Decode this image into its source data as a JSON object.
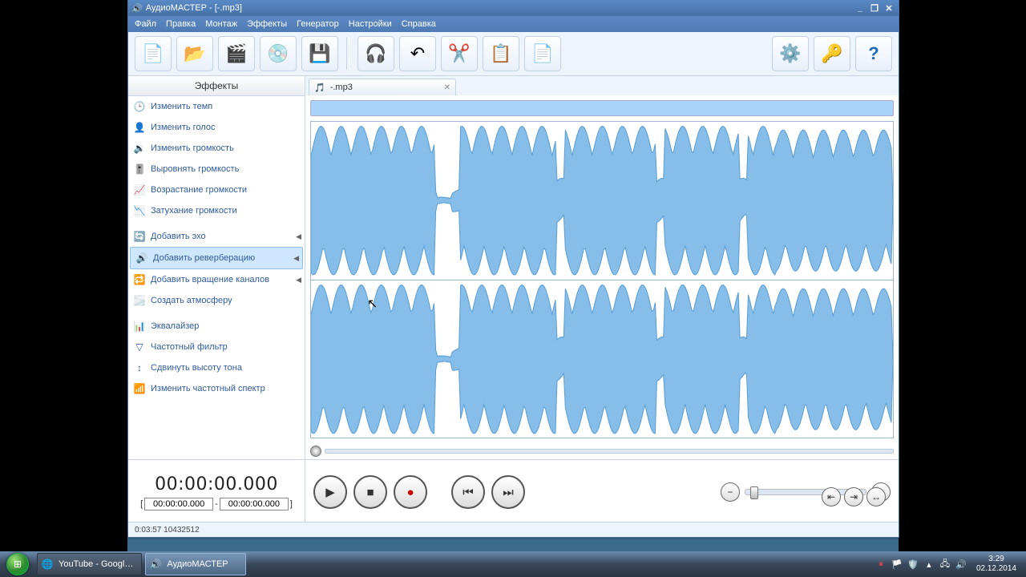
{
  "window": {
    "title": "АудиоМАСТЕР - [-.mp3]"
  },
  "menu": [
    "Файл",
    "Правка",
    "Монтаж",
    "Эффекты",
    "Генератор",
    "Настройки",
    "Справка"
  ],
  "toolbar_icons": [
    "new",
    "open",
    "video",
    "cd",
    "save",
    "listen",
    "undo",
    "cut",
    "copy",
    "paste",
    "settings",
    "key",
    "help"
  ],
  "sidebar": {
    "title": "Эффекты",
    "groups": [
      [
        "Изменить темп",
        "Изменить голос",
        "Изменить громкость",
        "Выровнять громкость",
        "Возрастание громкости",
        "Затухание громкости"
      ],
      [
        "Добавить эхо",
        "Добавить реверберацию",
        "Добавить вращение каналов",
        "Создать атмосферу"
      ],
      [
        "Эквалайзер",
        "Частотный фильтр",
        "Сдвинуть высоту тона",
        "Изменить частотный спектр"
      ]
    ],
    "submenu_items": [
      "Добавить эхо",
      "Добавить реверберацию",
      "Добавить вращение каналов"
    ],
    "selected": "Добавить реверберацию"
  },
  "tab": {
    "label": "-.mp3"
  },
  "time": {
    "big": "00:00:00.000",
    "from": "00:00:00.000",
    "to": "00:00:00.000",
    "sep": "-"
  },
  "status": "0:03:57 10432512",
  "taskbar": {
    "youtube": "YouTube - Googl…",
    "app": "АудиоМАСТЕР"
  },
  "clock": {
    "time": "3:29",
    "date": "02.12.2014"
  }
}
